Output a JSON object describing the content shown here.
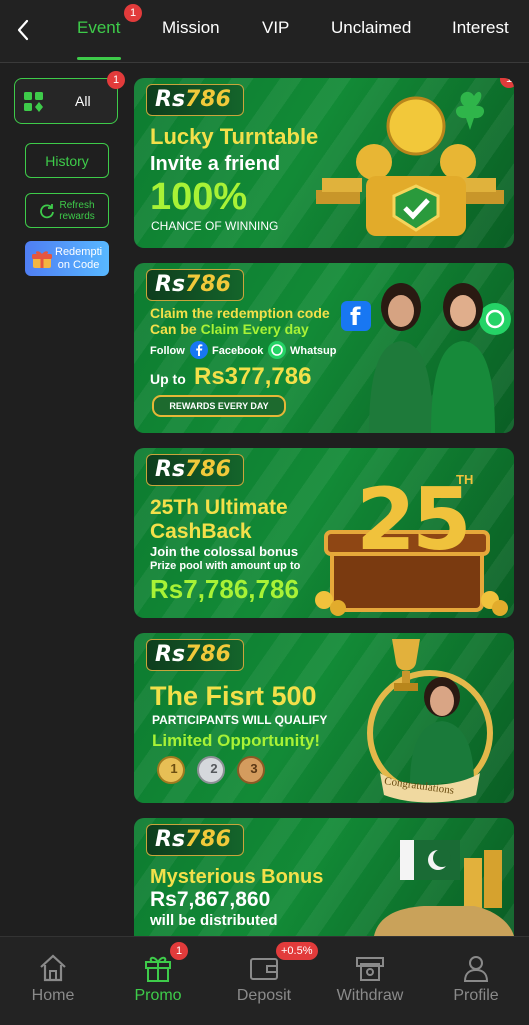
{
  "tabs": {
    "event": "Event",
    "event_badge": "1",
    "mission": "Mission",
    "vip": "VIP",
    "unclaimed": "Unclaimed",
    "interest": "Interest"
  },
  "sidebar": {
    "all_label": "All",
    "all_badge": "1",
    "history_label": "History",
    "refresh_line1": "Refresh",
    "refresh_line2": "rewards",
    "redeem_line1": "Redempti",
    "redeem_line2": "on Code"
  },
  "banners": {
    "logo_rs": "Rs",
    "logo_num": "786",
    "b1": {
      "badge": "1",
      "title": "Lucky Turntable",
      "subtitle": "Invite a friend",
      "big": "100%",
      "small": "CHANCE OF WINNING"
    },
    "b2": {
      "line1": "Claim the redemption code",
      "line2a": "Can be ",
      "line2b": "Claim Every day",
      "follow": "Follow",
      "facebook": "Facebook",
      "whatsup": "Whatsup",
      "upto": "Up to",
      "amount": "Rs377,786",
      "pill": "REWARDS EVERY DAY"
    },
    "b3": {
      "title1": "25Th Ultimate",
      "title2": "CashBack",
      "line1": "Join the colossal bonus",
      "line2": "Prize pool with amount up to",
      "amount": "Rs7,786,786",
      "big": "25",
      "th": "TH"
    },
    "b4": {
      "title": "The Fisrt 500",
      "line1": "PARTICIPANTS WILL QUALIFY",
      "line2": "Limited Opportunity!",
      "m1": "1",
      "m2": "2",
      "m3": "3",
      "congrats": "Congratulations"
    },
    "b5": {
      "title": "Mysterious Bonus",
      "amount": "Rs7,867,860",
      "line": "will be distributed"
    }
  },
  "bottom_nav": {
    "home": "Home",
    "promo": "Promo",
    "promo_badge": "1",
    "deposit": "Deposit",
    "deposit_badge": "+0.5%",
    "withdraw": "Withdraw",
    "profile": "Profile"
  },
  "colors": {
    "accent_green": "#3ecb4a",
    "badge_red": "#e23b3b",
    "banner_green": "#128a36",
    "gold": "#f1c93a"
  }
}
